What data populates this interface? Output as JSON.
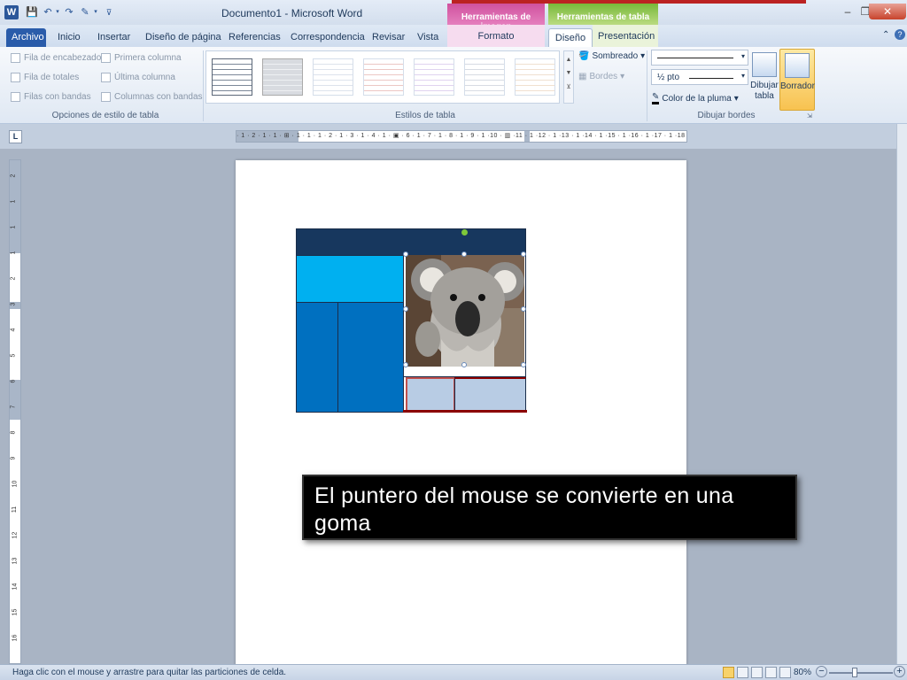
{
  "titlebar": {
    "app_icon": "W",
    "doc_title": "Documento1 - Microsoft Word",
    "ctx_image": "Herramientas de imagen",
    "ctx_table": "Herramientas de tabla",
    "minimize": "–",
    "restore": "❐",
    "close": "✕"
  },
  "tabs": {
    "archivo": "Archivo",
    "inicio": "Inicio",
    "insertar": "Insertar",
    "diseno_pagina": "Diseño de página",
    "referencias": "Referencias",
    "correspondencia": "Correspondencia",
    "revisar": "Revisar",
    "vista": "Vista",
    "formato": "Formato",
    "diseno": "Diseño",
    "presentacion": "Presentación"
  },
  "ribbon": {
    "opciones": {
      "label": "Opciones de estilo de tabla",
      "fila_encabezado": "Fila de encabezado",
      "primera_columna": "Primera columna",
      "fila_totales": "Fila de totales",
      "ultima_columna": "Última columna",
      "filas_bandas": "Filas con bandas",
      "columnas_bandas": "Columnas con bandas"
    },
    "estilos": {
      "label": "Estilos de tabla",
      "sombreado": "Sombreado",
      "bordes": "Bordes"
    },
    "dibujar": {
      "label": "Dibujar bordes",
      "pen_weight": "½ pto",
      "color_pluma": "Color de la pluma",
      "dibujar_tabla": "Dibujar tabla",
      "borrador": "Borrador"
    }
  },
  "ruler": {
    "h_text": "· 1 · 2 · 1 · 1 · ⊞ · 1 · 1 · 1 · 2 · 1 · 3 · 1 · 4 · 1 · ▣ · 6 · 1 · 7 · 1 · 8 · 1 · 9 · 1 ·10 · ▥ ·11 · 1 ·12 · 1 ·13 · 1 ·14 · 1 ·15 · 1 ·16 · 1 ·17 · 1 ·18",
    "v_numbers": [
      "2",
      "1",
      "1",
      "1",
      "2",
      "3",
      "4",
      "5",
      "6",
      "7",
      "8",
      "9",
      "10",
      "11",
      "12",
      "13",
      "14",
      "15",
      "16"
    ],
    "corner": "L"
  },
  "caption": "El puntero del mouse se convierte en una goma",
  "status": {
    "text": "Haga clic con el mouse y arrastre para quitar las particiones de celda.",
    "zoom": "80%",
    "zoom_minus": "−",
    "zoom_plus": "+"
  },
  "colors": {
    "table_dark": "#17375e",
    "table_cyan": "#00b0f0",
    "table_blue": "#0070c0",
    "table_light": "#b8cce4",
    "eraser_border": "#c0504d"
  }
}
